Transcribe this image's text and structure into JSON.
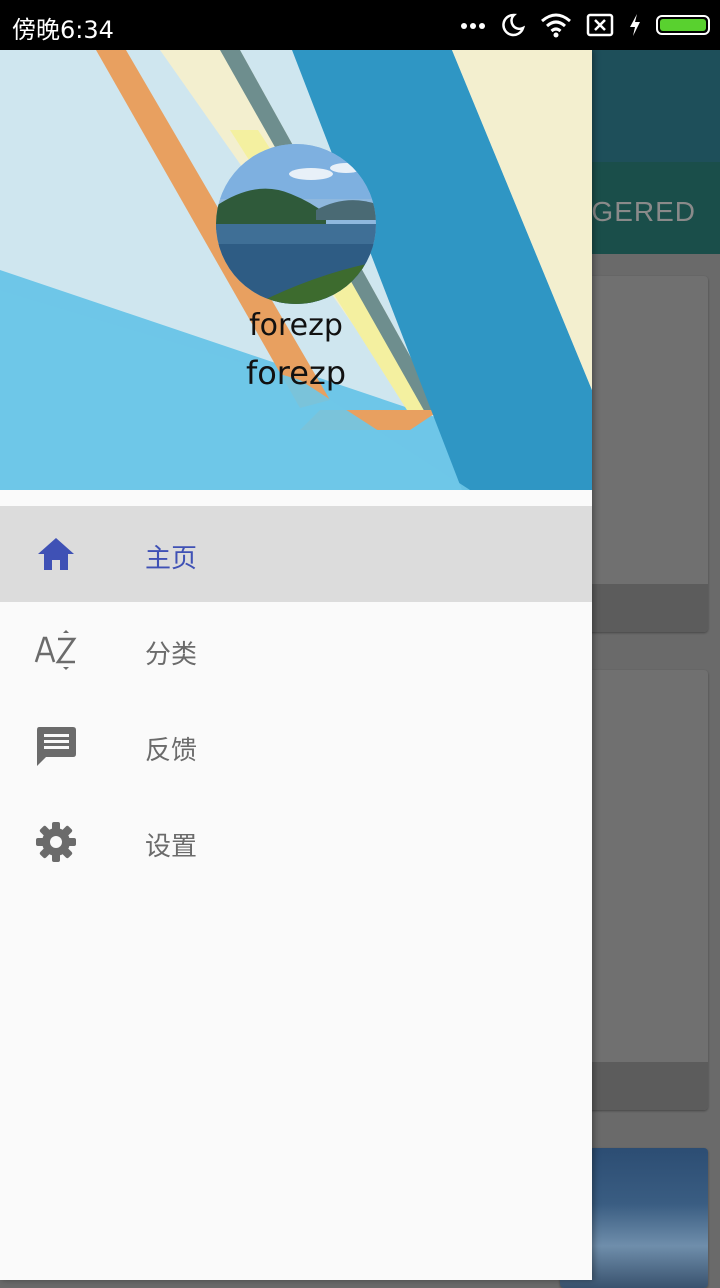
{
  "status_bar": {
    "time": "傍晚6:34",
    "icons": [
      "more-dots-icon",
      "moon-icon",
      "wifi-icon",
      "sim-x-icon",
      "charging-icon",
      "battery-icon"
    ]
  },
  "background_app": {
    "tab_label": "GGERED"
  },
  "drawer": {
    "header": {
      "name_line1": "forezp",
      "name_line2": "forezp"
    },
    "menu": [
      {
        "label": "主页",
        "icon": "home-icon",
        "active": true
      },
      {
        "label": "分类",
        "icon": "sort-az-icon",
        "active": false
      },
      {
        "label": "反馈",
        "icon": "feedback-icon",
        "active": false
      },
      {
        "label": "设置",
        "icon": "settings-icon",
        "active": false
      }
    ]
  },
  "colors": {
    "accent": "#3f51b5",
    "menu_active_bg": "#dcdcdc",
    "icon_gray": "#6b6b6b"
  }
}
